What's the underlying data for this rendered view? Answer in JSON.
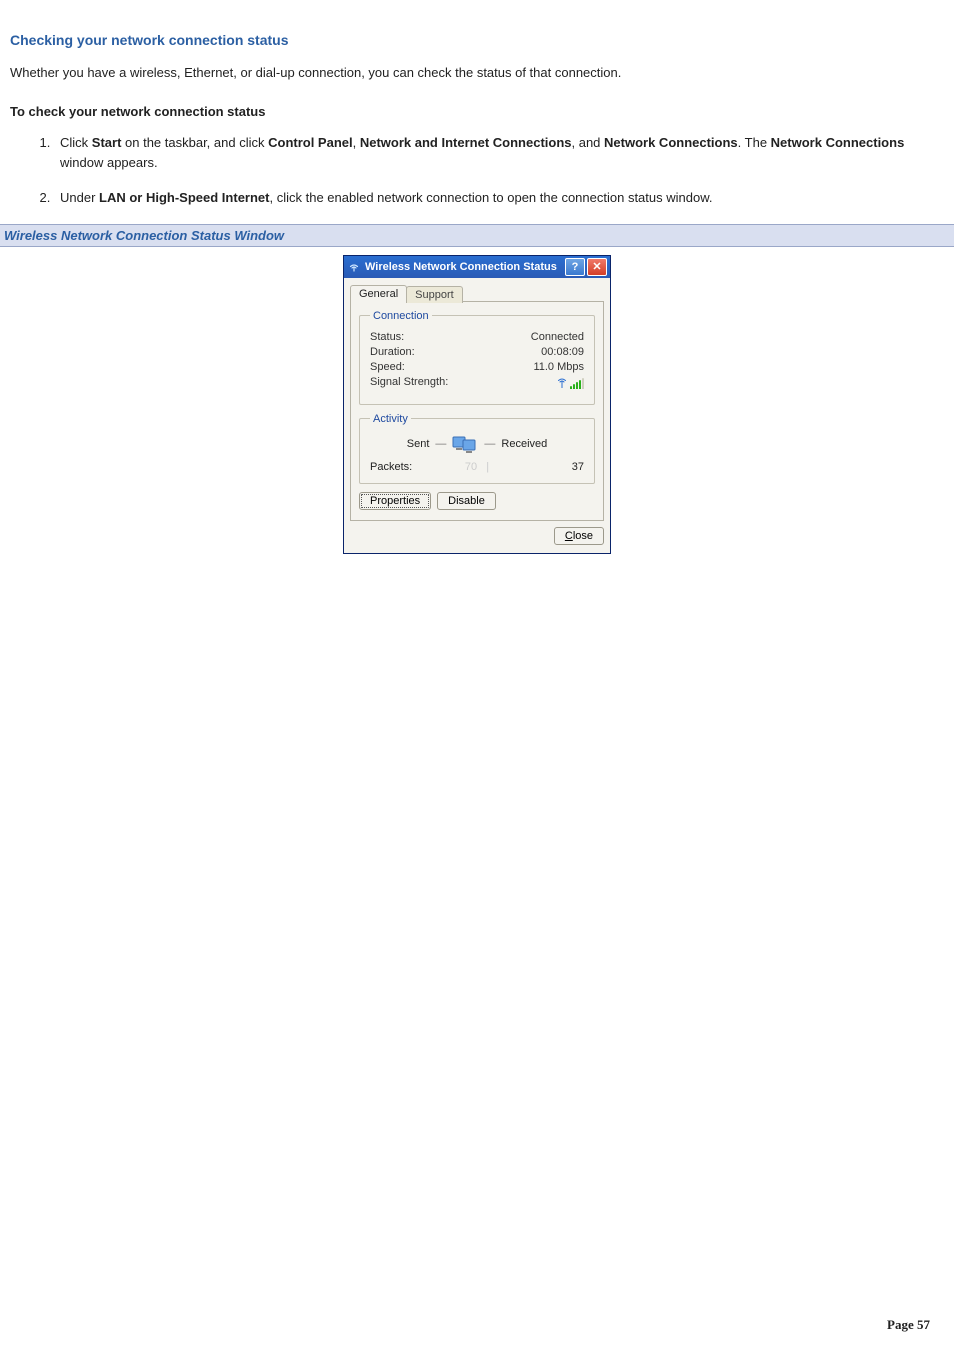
{
  "doc": {
    "heading": "Checking your network connection status",
    "intro": "Whether you have a wireless, Ethernet, or dial-up connection, you can check the status of that connection.",
    "procedure_title": "To check your network connection status",
    "steps": {
      "s1": {
        "pre1": "Click ",
        "b1": "Start",
        "mid1": " on the taskbar, and click ",
        "b2": "Control Panel",
        "mid2": ", ",
        "b3": "Network and Internet Connections",
        "mid3": ", and ",
        "b4": "Network Connections",
        "mid4": ". The ",
        "b5": "Network Connections",
        "post": " window appears."
      },
      "s2": {
        "pre1": "Under ",
        "b1": "LAN or High-Speed Internet",
        "post": ", click the enabled network connection to open the connection status window."
      }
    },
    "caption": "Wireless Network Connection Status Window"
  },
  "dialog": {
    "title": "Wireless Network Connection Status",
    "help_glyph": "?",
    "close_glyph": "✕",
    "tabs": {
      "general": "General",
      "support": "Support"
    },
    "groups": {
      "connection_legend": "Connection",
      "activity_legend": "Activity"
    },
    "connection": {
      "status_label": "Status:",
      "status_value": "Connected",
      "duration_label": "Duration:",
      "duration_value": "00:08:09",
      "speed_label": "Speed:",
      "speed_value": "11.0 Mbps",
      "signal_label": "Signal Strength:"
    },
    "activity": {
      "sent_label": "Sent",
      "received_label": "Received",
      "packets_label": "Packets:",
      "packets_sent": "70",
      "packets_divider": "|",
      "packets_received": "37"
    },
    "buttons": {
      "properties": "Properties",
      "disable": "Disable",
      "close": "Close"
    }
  },
  "footer": {
    "label": "Page ",
    "num": "57"
  }
}
